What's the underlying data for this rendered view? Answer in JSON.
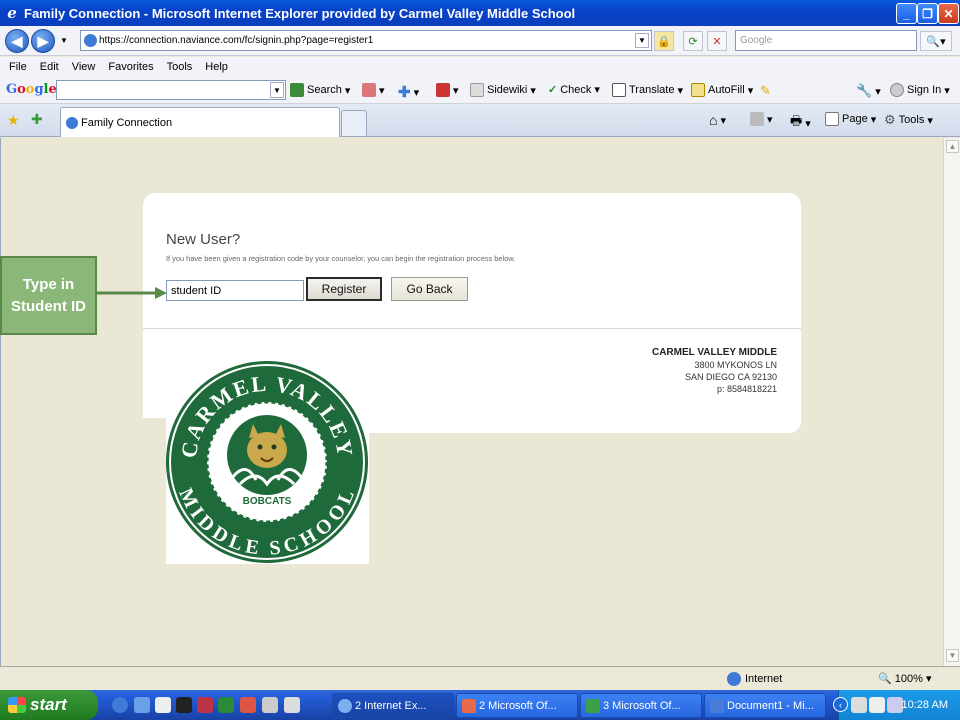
{
  "window": {
    "title": "Family Connection - Microsoft Internet Explorer provided by Carmel Valley Middle School"
  },
  "address_bar": {
    "url": "https://connection.naviance.com/fc/signin.php?page=register1",
    "search_placeholder": "Google"
  },
  "menu": [
    "File",
    "Edit",
    "View",
    "Favorites",
    "Tools",
    "Help"
  ],
  "google_toolbar": {
    "logo": "Google",
    "search_label": "Search",
    "sidewiki_label": "Sidewiki",
    "check_label": "Check",
    "translate_label": "Translate",
    "autofill_label": "AutoFill",
    "signin_label": "Sign In"
  },
  "tabs": {
    "active_label": "Family Connection"
  },
  "command_bar": {
    "page_label": "Page",
    "tools_label": "Tools"
  },
  "page": {
    "heading": "New User?",
    "subtext": "If you have been given a registration code by your counselor, you can begin the registration process below.",
    "id_field_value": "student ID",
    "register_label": "Register",
    "go_back_label": "Go Back",
    "school": {
      "name": "CARMEL VALLEY MIDDLE",
      "street": "3800 MYKONOS LN",
      "city": "SAN DIEGO CA 92130",
      "phone": "p: 8584818221"
    },
    "logo": {
      "top_text": "CARMEL VALLEY",
      "bottom_text": "MIDDLE SCHOOL",
      "mascot": "BOBCATS"
    }
  },
  "callout": {
    "text": "Type in Student ID"
  },
  "status_bar": {
    "zone": "Internet",
    "zoom": "100%"
  },
  "taskbar": {
    "start_label": "start",
    "tasks": [
      "2 Internet Ex...",
      "2 Microsoft Of...",
      "3 Microsoft Of...",
      "Document1 - Mi..."
    ],
    "clock": "10:28 AM"
  },
  "colors": {
    "titlebar": "#0a48cf",
    "callout_fill": "#8bb779",
    "logo_green": "#1f6a3a",
    "logo_gold": "#c9a94c"
  }
}
